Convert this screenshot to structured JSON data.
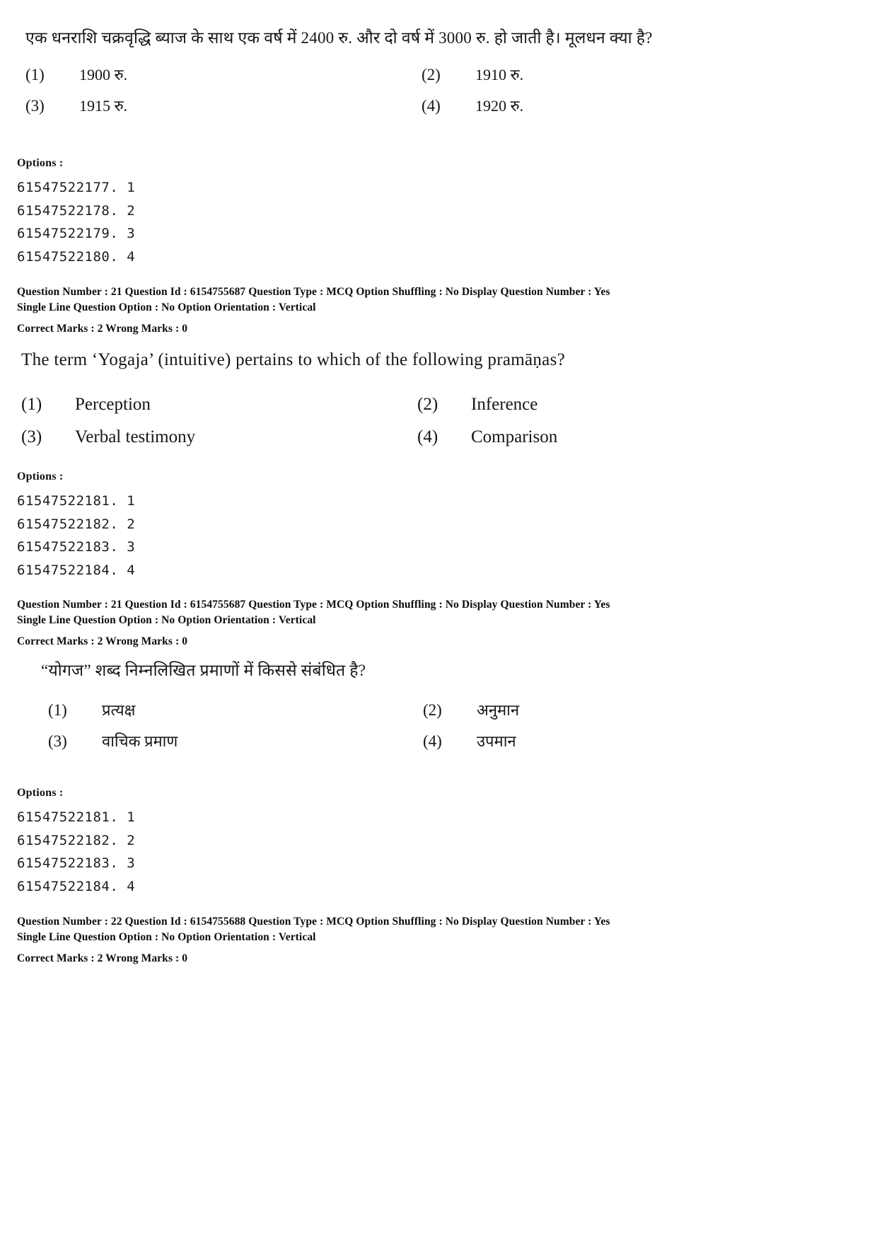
{
  "document": {
    "type": "exam-question-paper-scan"
  },
  "blocks": [
    {
      "kind": "question",
      "language": "hindi",
      "stem": "एक धनराशि चक्रवृद्धि ब्याज के साथ एक वर्ष में 2400 रु. और दो वर्ष में 3000 रु. हो जाती है। मूलधन क्या है?",
      "options": [
        {
          "num": "(1)",
          "text": "1900 रु."
        },
        {
          "num": "(2)",
          "text": "1910 रु."
        },
        {
          "num": "(3)",
          "text": "1915 रु."
        },
        {
          "num": "(4)",
          "text": "1920 रु."
        }
      ]
    },
    {
      "kind": "options-ids",
      "label": "Options :",
      "ids": [
        "61547522177. 1",
        "61547522178. 2",
        "61547522179. 3",
        "61547522180. 4"
      ]
    },
    {
      "kind": "meta",
      "line1": "Question Number : 21  Question Id : 6154755687  Question Type : MCQ  Option Shuffling : No  Display Question Number : Yes",
      "line2": "Single Line Question Option : No  Option Orientation : Vertical",
      "line3": "Correct Marks : 2  Wrong Marks : 0"
    },
    {
      "kind": "question",
      "language": "english",
      "stem": "The term ‘Yogaja’ (intuitive) pertains to which of the following  pramāṇas?",
      "options": [
        {
          "num": "(1)",
          "text": "Perception"
        },
        {
          "num": "(2)",
          "text": "Inference"
        },
        {
          "num": "(3)",
          "text": "Verbal testimony"
        },
        {
          "num": "(4)",
          "text": "Comparison"
        }
      ]
    },
    {
      "kind": "options-ids",
      "label": "Options :",
      "ids": [
        "61547522181. 1",
        "61547522182. 2",
        "61547522183. 3",
        "61547522184. 4"
      ]
    },
    {
      "kind": "meta",
      "line1": "Question Number : 21  Question Id : 6154755687  Question Type : MCQ  Option Shuffling : No  Display Question Number : Yes",
      "line2": "Single Line Question Option : No  Option Orientation : Vertical",
      "line3": "Correct Marks : 2  Wrong Marks : 0"
    },
    {
      "kind": "question",
      "language": "hindi",
      "stem": "“योगज” शब्द निम्नलिखित प्रमाणों में किससे संबंधित है?",
      "options": [
        {
          "num": "(1)",
          "text": "प्रत्यक्ष"
        },
        {
          "num": "(2)",
          "text": "अनुमान"
        },
        {
          "num": "(3)",
          "text": "वाचिक प्रमाण"
        },
        {
          "num": "(4)",
          "text": "उपमान"
        }
      ]
    },
    {
      "kind": "options-ids",
      "label": "Options :",
      "ids": [
        "61547522181. 1",
        "61547522182. 2",
        "61547522183. 3",
        "61547522184. 4"
      ]
    },
    {
      "kind": "meta",
      "line1": "Question Number : 22  Question Id : 6154755688  Question Type : MCQ  Option Shuffling : No  Display Question Number : Yes",
      "line2": "Single Line Question Option : No  Option Orientation : Vertical",
      "line3": "Correct Marks : 2  Wrong Marks : 0"
    }
  ]
}
